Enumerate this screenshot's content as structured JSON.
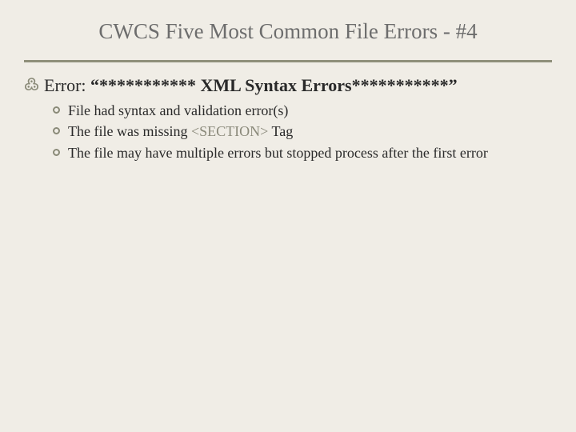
{
  "slide": {
    "title": "CWCS Five Most Common File Errors - #4",
    "main_bullet": {
      "prefix": "Error: ",
      "message": "“*********** XML Syntax Errors***********”"
    },
    "sub_bullets": [
      {
        "text": "File had syntax and validation error(s)"
      },
      {
        "prefix": "The file was missing ",
        "tag": "<SECTION>",
        "suffix": " Tag"
      },
      {
        "text": "The file may have multiple errors but stopped process after the first error"
      }
    ]
  }
}
